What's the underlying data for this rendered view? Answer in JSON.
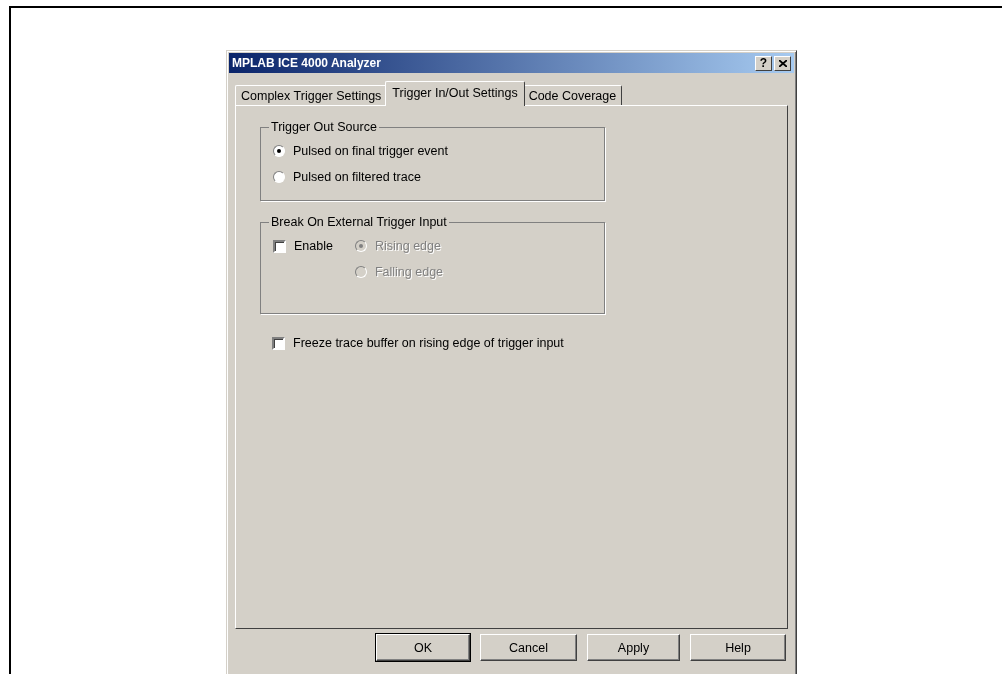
{
  "window": {
    "title": "MPLAB ICE 4000 Analyzer",
    "title_buttons": [
      {
        "kind": "help",
        "label": "?"
      },
      {
        "kind": "close"
      }
    ]
  },
  "tabs": [
    {
      "label": "Complex Trigger Settings",
      "selected": false
    },
    {
      "label": "Trigger In/Out Settings",
      "selected": true
    },
    {
      "label": "Code Coverage",
      "selected": false
    }
  ],
  "trigger_out_source": {
    "title": "Trigger Out Source",
    "options": [
      {
        "label": "Pulsed on final trigger event",
        "selected": true,
        "disabled": false
      },
      {
        "label": "Pulsed on filtered trace",
        "selected": false,
        "disabled": false
      }
    ]
  },
  "break_on_external_trigger": {
    "title": "Break On External Trigger Input",
    "enable": {
      "label": "Enable",
      "checked": false
    },
    "options": [
      {
        "label": "Rising edge",
        "selected": true,
        "disabled": true
      },
      {
        "label": "Falling edge",
        "selected": false,
        "disabled": true
      }
    ]
  },
  "freeze_trace": {
    "label": "Freeze trace buffer on rising edge of trigger input",
    "checked": false
  },
  "buttons": [
    {
      "label": "OK",
      "default": true
    },
    {
      "label": "Cancel",
      "default": false
    },
    {
      "label": "Apply",
      "default": false
    },
    {
      "label": "Help",
      "default": false
    }
  ]
}
